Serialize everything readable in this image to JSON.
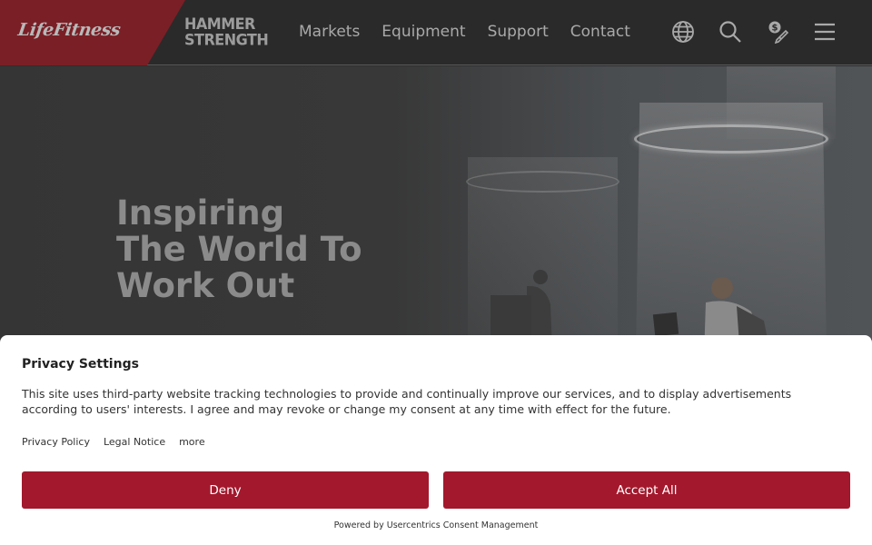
{
  "header": {
    "brand_primary": "LifeFitness",
    "brand_secondary_line1": "HAMMER",
    "brand_secondary_line2": "STRENGTH",
    "nav": [
      "Markets",
      "Equipment",
      "Support",
      "Contact"
    ],
    "icons": [
      "globe-icon",
      "search-icon",
      "price-tag-icon",
      "menu-icon"
    ]
  },
  "hero": {
    "title_lines": [
      "Inspiring",
      "The World To",
      "Work Out"
    ]
  },
  "consent": {
    "title": "Privacy Settings",
    "body": "This site uses third-party website tracking technologies to provide and continually improve our services, and to display advertisements according to users' interests. I agree and may revoke or change my consent at any time with effect for the future.",
    "links": [
      "Privacy Policy",
      "Legal Notice",
      "more"
    ],
    "deny_label": "Deny",
    "accept_label": "Accept All",
    "powered_prefix": "Powered by",
    "powered_link": "Usercentrics Consent Management"
  },
  "colors": {
    "brand_red": "#a3182c",
    "logo_red": "#7a1f26",
    "header_bg": "#2a2a2a"
  }
}
